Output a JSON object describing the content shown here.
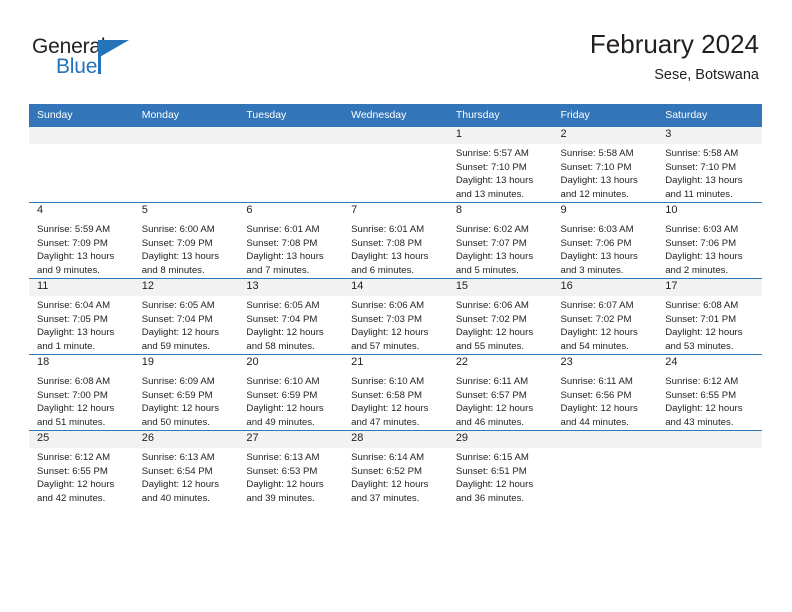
{
  "logo": {
    "word1": "General",
    "word2": "Blue",
    "icon": "flag-triangle-icon"
  },
  "header": {
    "title": "February 2024",
    "location": "Sese, Botswana"
  },
  "calendar": {
    "weekday_headers": [
      "Sunday",
      "Monday",
      "Tuesday",
      "Wednesday",
      "Thursday",
      "Friday",
      "Saturday"
    ],
    "accent_color": "#3275b8",
    "daynum_band_color": "#f2f2f2",
    "weeks": [
      [
        {
          "day": "",
          "sunrise": "",
          "sunset": "",
          "daylight1": "",
          "daylight2": ""
        },
        {
          "day": "",
          "sunrise": "",
          "sunset": "",
          "daylight1": "",
          "daylight2": ""
        },
        {
          "day": "",
          "sunrise": "",
          "sunset": "",
          "daylight1": "",
          "daylight2": ""
        },
        {
          "day": "",
          "sunrise": "",
          "sunset": "",
          "daylight1": "",
          "daylight2": ""
        },
        {
          "day": "1",
          "sunrise": "Sunrise: 5:57 AM",
          "sunset": "Sunset: 7:10 PM",
          "daylight1": "Daylight: 13 hours",
          "daylight2": "and 13 minutes."
        },
        {
          "day": "2",
          "sunrise": "Sunrise: 5:58 AM",
          "sunset": "Sunset: 7:10 PM",
          "daylight1": "Daylight: 13 hours",
          "daylight2": "and 12 minutes."
        },
        {
          "day": "3",
          "sunrise": "Sunrise: 5:58 AM",
          "sunset": "Sunset: 7:10 PM",
          "daylight1": "Daylight: 13 hours",
          "daylight2": "and 11 minutes."
        }
      ],
      [
        {
          "day": "4",
          "sunrise": "Sunrise: 5:59 AM",
          "sunset": "Sunset: 7:09 PM",
          "daylight1": "Daylight: 13 hours",
          "daylight2": "and 9 minutes."
        },
        {
          "day": "5",
          "sunrise": "Sunrise: 6:00 AM",
          "sunset": "Sunset: 7:09 PM",
          "daylight1": "Daylight: 13 hours",
          "daylight2": "and 8 minutes."
        },
        {
          "day": "6",
          "sunrise": "Sunrise: 6:01 AM",
          "sunset": "Sunset: 7:08 PM",
          "daylight1": "Daylight: 13 hours",
          "daylight2": "and 7 minutes."
        },
        {
          "day": "7",
          "sunrise": "Sunrise: 6:01 AM",
          "sunset": "Sunset: 7:08 PM",
          "daylight1": "Daylight: 13 hours",
          "daylight2": "and 6 minutes."
        },
        {
          "day": "8",
          "sunrise": "Sunrise: 6:02 AM",
          "sunset": "Sunset: 7:07 PM",
          "daylight1": "Daylight: 13 hours",
          "daylight2": "and 5 minutes."
        },
        {
          "day": "9",
          "sunrise": "Sunrise: 6:03 AM",
          "sunset": "Sunset: 7:06 PM",
          "daylight1": "Daylight: 13 hours",
          "daylight2": "and 3 minutes."
        },
        {
          "day": "10",
          "sunrise": "Sunrise: 6:03 AM",
          "sunset": "Sunset: 7:06 PM",
          "daylight1": "Daylight: 13 hours",
          "daylight2": "and 2 minutes."
        }
      ],
      [
        {
          "day": "11",
          "sunrise": "Sunrise: 6:04 AM",
          "sunset": "Sunset: 7:05 PM",
          "daylight1": "Daylight: 13 hours",
          "daylight2": "and 1 minute."
        },
        {
          "day": "12",
          "sunrise": "Sunrise: 6:05 AM",
          "sunset": "Sunset: 7:04 PM",
          "daylight1": "Daylight: 12 hours",
          "daylight2": "and 59 minutes."
        },
        {
          "day": "13",
          "sunrise": "Sunrise: 6:05 AM",
          "sunset": "Sunset: 7:04 PM",
          "daylight1": "Daylight: 12 hours",
          "daylight2": "and 58 minutes."
        },
        {
          "day": "14",
          "sunrise": "Sunrise: 6:06 AM",
          "sunset": "Sunset: 7:03 PM",
          "daylight1": "Daylight: 12 hours",
          "daylight2": "and 57 minutes."
        },
        {
          "day": "15",
          "sunrise": "Sunrise: 6:06 AM",
          "sunset": "Sunset: 7:02 PM",
          "daylight1": "Daylight: 12 hours",
          "daylight2": "and 55 minutes."
        },
        {
          "day": "16",
          "sunrise": "Sunrise: 6:07 AM",
          "sunset": "Sunset: 7:02 PM",
          "daylight1": "Daylight: 12 hours",
          "daylight2": "and 54 minutes."
        },
        {
          "day": "17",
          "sunrise": "Sunrise: 6:08 AM",
          "sunset": "Sunset: 7:01 PM",
          "daylight1": "Daylight: 12 hours",
          "daylight2": "and 53 minutes."
        }
      ],
      [
        {
          "day": "18",
          "sunrise": "Sunrise: 6:08 AM",
          "sunset": "Sunset: 7:00 PM",
          "daylight1": "Daylight: 12 hours",
          "daylight2": "and 51 minutes."
        },
        {
          "day": "19",
          "sunrise": "Sunrise: 6:09 AM",
          "sunset": "Sunset: 6:59 PM",
          "daylight1": "Daylight: 12 hours",
          "daylight2": "and 50 minutes."
        },
        {
          "day": "20",
          "sunrise": "Sunrise: 6:10 AM",
          "sunset": "Sunset: 6:59 PM",
          "daylight1": "Daylight: 12 hours",
          "daylight2": "and 49 minutes."
        },
        {
          "day": "21",
          "sunrise": "Sunrise: 6:10 AM",
          "sunset": "Sunset: 6:58 PM",
          "daylight1": "Daylight: 12 hours",
          "daylight2": "and 47 minutes."
        },
        {
          "day": "22",
          "sunrise": "Sunrise: 6:11 AM",
          "sunset": "Sunset: 6:57 PM",
          "daylight1": "Daylight: 12 hours",
          "daylight2": "and 46 minutes."
        },
        {
          "day": "23",
          "sunrise": "Sunrise: 6:11 AM",
          "sunset": "Sunset: 6:56 PM",
          "daylight1": "Daylight: 12 hours",
          "daylight2": "and 44 minutes."
        },
        {
          "day": "24",
          "sunrise": "Sunrise: 6:12 AM",
          "sunset": "Sunset: 6:55 PM",
          "daylight1": "Daylight: 12 hours",
          "daylight2": "and 43 minutes."
        }
      ],
      [
        {
          "day": "25",
          "sunrise": "Sunrise: 6:12 AM",
          "sunset": "Sunset: 6:55 PM",
          "daylight1": "Daylight: 12 hours",
          "daylight2": "and 42 minutes."
        },
        {
          "day": "26",
          "sunrise": "Sunrise: 6:13 AM",
          "sunset": "Sunset: 6:54 PM",
          "daylight1": "Daylight: 12 hours",
          "daylight2": "and 40 minutes."
        },
        {
          "day": "27",
          "sunrise": "Sunrise: 6:13 AM",
          "sunset": "Sunset: 6:53 PM",
          "daylight1": "Daylight: 12 hours",
          "daylight2": "and 39 minutes."
        },
        {
          "day": "28",
          "sunrise": "Sunrise: 6:14 AM",
          "sunset": "Sunset: 6:52 PM",
          "daylight1": "Daylight: 12 hours",
          "daylight2": "and 37 minutes."
        },
        {
          "day": "29",
          "sunrise": "Sunrise: 6:15 AM",
          "sunset": "Sunset: 6:51 PM",
          "daylight1": "Daylight: 12 hours",
          "daylight2": "and 36 minutes."
        },
        {
          "day": "",
          "sunrise": "",
          "sunset": "",
          "daylight1": "",
          "daylight2": ""
        },
        {
          "day": "",
          "sunrise": "",
          "sunset": "",
          "daylight1": "",
          "daylight2": ""
        }
      ]
    ]
  }
}
